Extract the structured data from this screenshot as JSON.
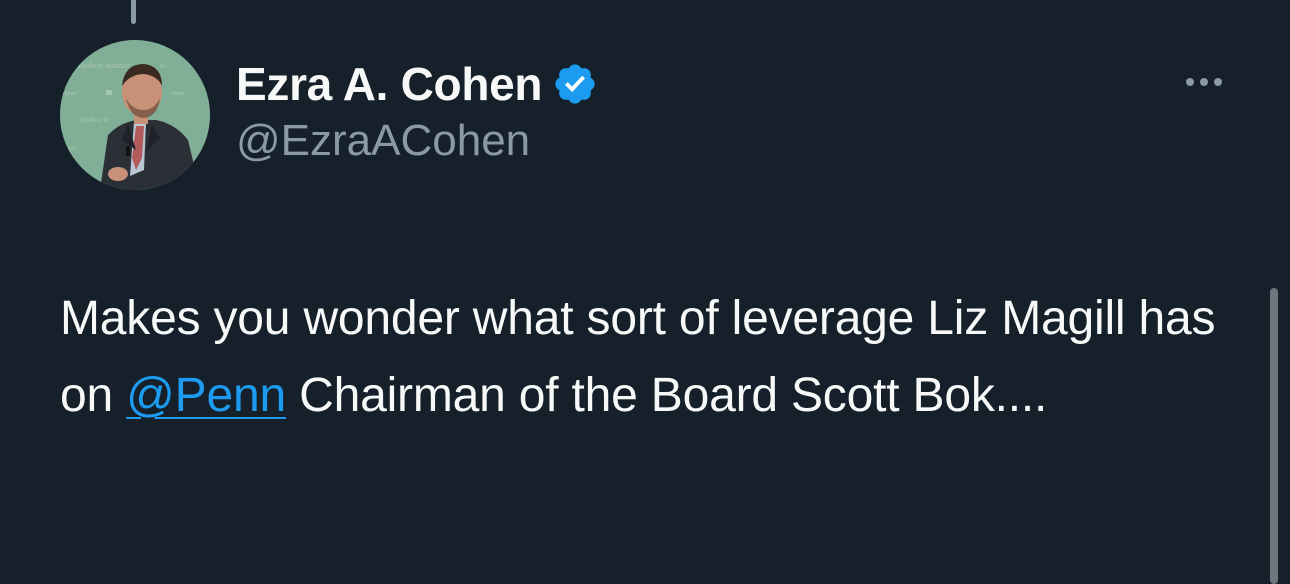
{
  "author": {
    "display_name": "Ezra A. Cohen",
    "handle": "@EzraACohen",
    "verified": true,
    "avatar_backdrop_text": [
      "Hudson Institute",
      "Hudson Institute",
      "stitute",
      "Hudson In",
      "titute"
    ]
  },
  "tweet": {
    "text_before_mention": "Makes you wonder what sort of leverage Liz Magill has on ",
    "mention": "@Penn",
    "text_after_mention": " Chairman of the Board Scott Bok...."
  },
  "icons": {
    "more": "more-horizontal-icon",
    "verified": "verified-badge-icon"
  },
  "colors": {
    "background": "#15202b",
    "text_primary": "#f7f9f9",
    "text_secondary": "#8b98a5",
    "accent": "#1d9bf0"
  }
}
